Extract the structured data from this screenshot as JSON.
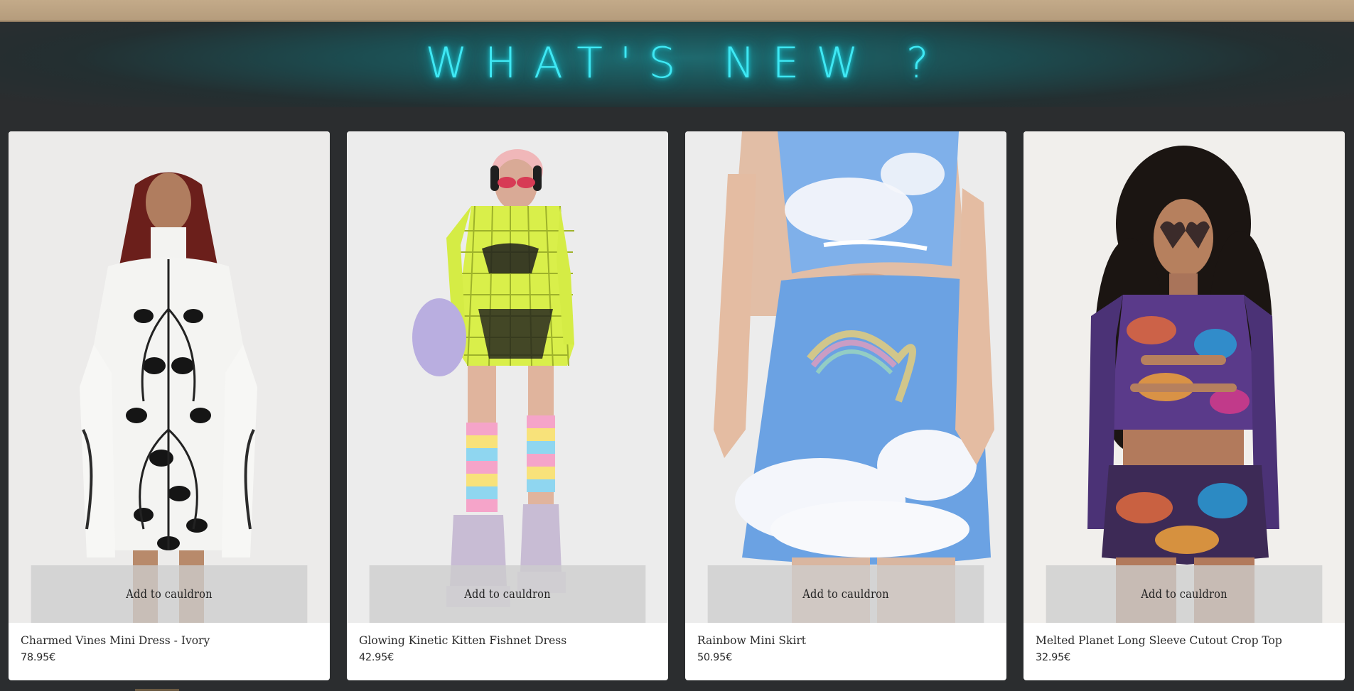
{
  "hero": {
    "title": "WHAT'S NEW ?"
  },
  "products": [
    {
      "name": "Charmed Vines Mini Dress - Ivory",
      "price": "78.95€",
      "cta": "Add to cauldron",
      "image_icon": "dress-photo"
    },
    {
      "name": "Glowing Kinetic Kitten Fishnet Dress",
      "price": "42.95€",
      "cta": "Add to cauldron",
      "image_icon": "dress-photo"
    },
    {
      "name": "Rainbow Mini Skirt",
      "price": "50.95€",
      "cta": "Add to cauldron",
      "image_icon": "skirt-photo"
    },
    {
      "name": "Melted Planet Long Sleeve Cutout Crop Top",
      "price": "32.95€",
      "cta": "Add to cauldron",
      "image_icon": "crop-top-photo"
    }
  ],
  "colors": {
    "page_background": "#2b2d2f",
    "title_glow": "#3fe8f4",
    "top_strip": "#c3aa89",
    "card_background": "#ffffff"
  }
}
